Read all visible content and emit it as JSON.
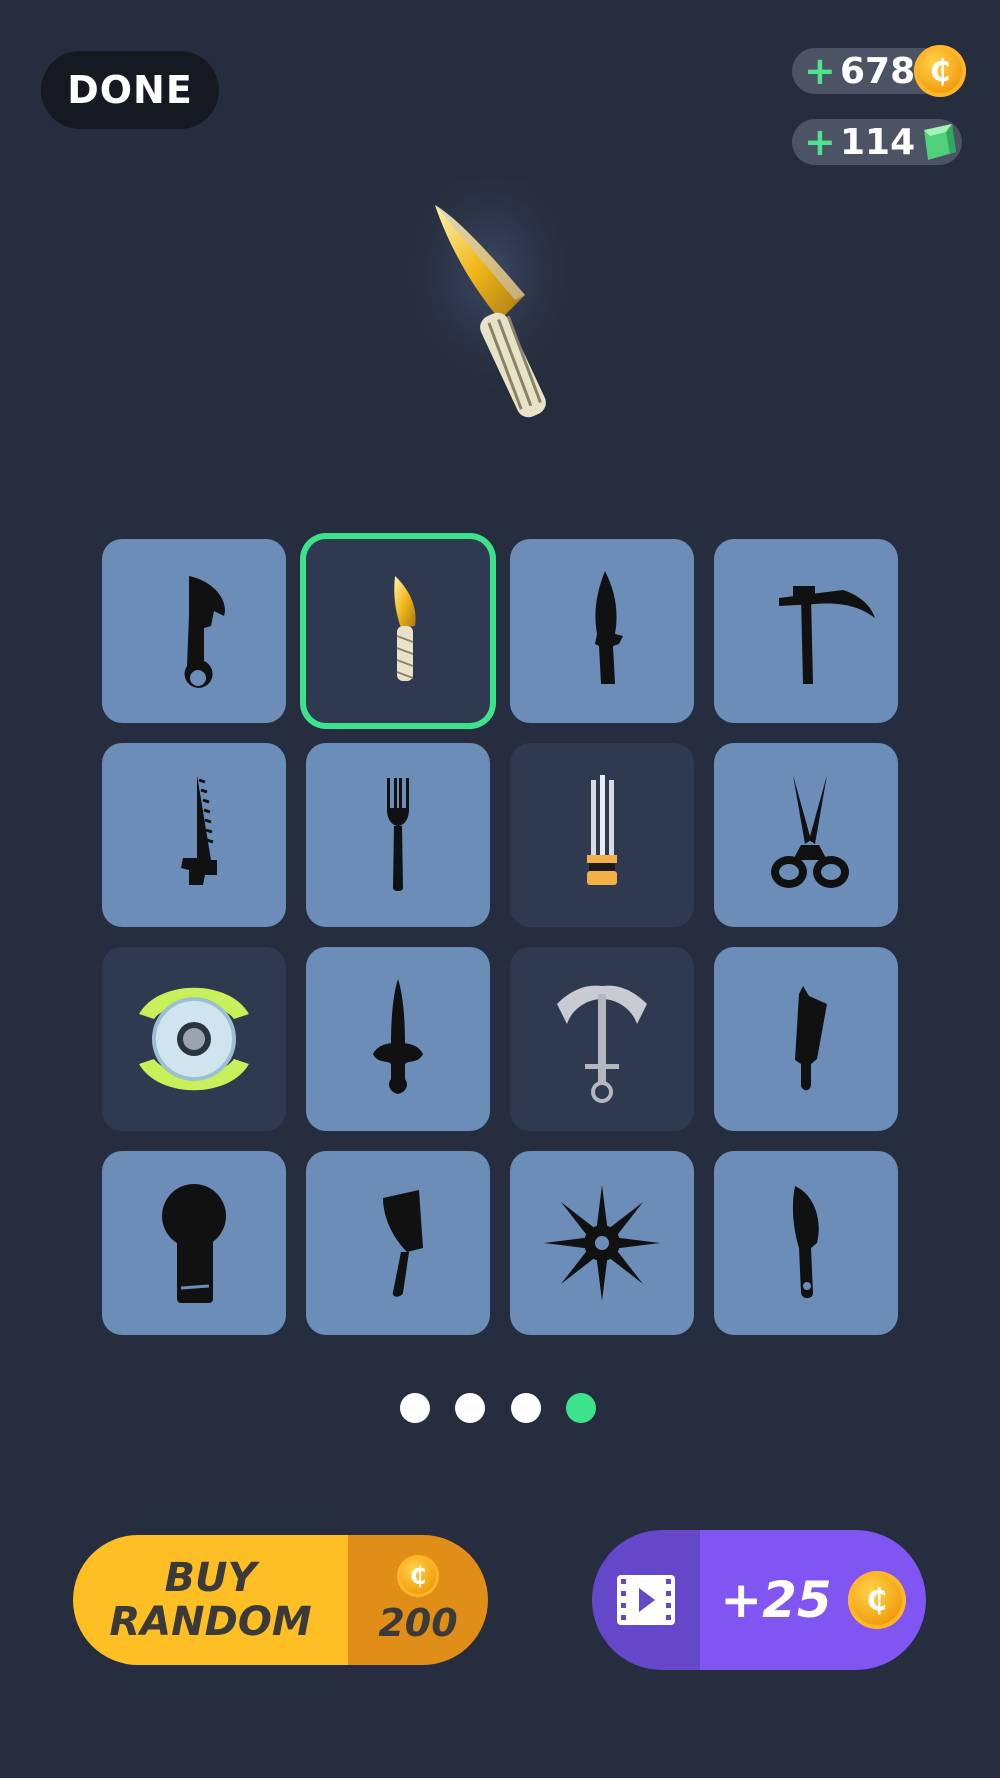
{
  "header": {
    "done_label": "DONE",
    "coins": {
      "plus": "+",
      "amount": "678",
      "icon": "coin-icon"
    },
    "gems": {
      "plus": "+",
      "amount": "114",
      "icon": "gem-icon"
    }
  },
  "preview": {
    "icon": "golden-karambit-knife"
  },
  "grid": {
    "items": [
      {
        "icon": "karambit-silhouette",
        "state": "locked"
      },
      {
        "icon": "golden-knife",
        "state": "selected"
      },
      {
        "icon": "combat-knife-silhouette",
        "state": "locked"
      },
      {
        "icon": "scythe-silhouette",
        "state": "locked"
      },
      {
        "icon": "saw-silhouette",
        "state": "locked"
      },
      {
        "icon": "fork-silhouette",
        "state": "locked"
      },
      {
        "icon": "trident-claw",
        "state": "owned"
      },
      {
        "icon": "scissors-silhouette",
        "state": "locked"
      },
      {
        "icon": "double-blade-disc",
        "state": "owned"
      },
      {
        "icon": "dagger-silhouette",
        "state": "locked"
      },
      {
        "icon": "anchor",
        "state": "owned"
      },
      {
        "icon": "machete-silhouette",
        "state": "locked"
      },
      {
        "icon": "key-blade-silhouette",
        "state": "locked"
      },
      {
        "icon": "cleaver-silhouette",
        "state": "locked"
      },
      {
        "icon": "shuriken-silhouette",
        "state": "locked"
      },
      {
        "icon": "hunting-knife-silhouette",
        "state": "locked"
      }
    ]
  },
  "pagination": {
    "total": 4,
    "active": 4
  },
  "buy_random": {
    "line1": "BUY",
    "line2": "RANDOM",
    "price": "200",
    "coin_symbol": "₵"
  },
  "video_reward": {
    "label": "+25",
    "coin_symbol": "₵"
  },
  "colors": {
    "background": "#262d3e",
    "tile_locked": "#6b8db8",
    "tile_owned": "#2f3950",
    "accent_green": "#3de38b",
    "buy_yellow": "#fdbf24",
    "reward_purple": "#8055f2"
  }
}
